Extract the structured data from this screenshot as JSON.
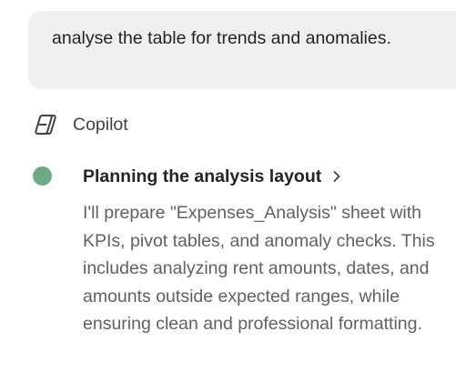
{
  "user_message": {
    "text": "analyse the table for trends and anomalies."
  },
  "assistant": {
    "name": "Copilot",
    "icon": "copilot-logo-icon"
  },
  "step": {
    "status_color": "#6fa887",
    "title": "Planning the analysis layout",
    "chevron": "chevron-right-icon",
    "body": "I'll prepare \"Expenses_Analysis\" sheet with KPIs, pivot tables, and anomaly checks. This includes analyzing rent amounts, dates, and amounts outside expected ranges, while ensuring clean and professional formatting."
  }
}
